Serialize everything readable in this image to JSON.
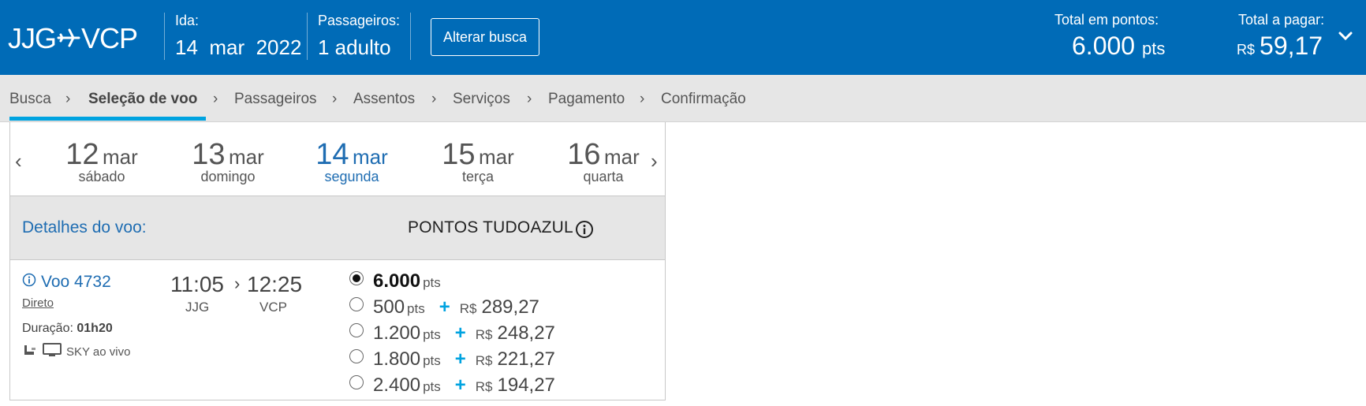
{
  "header": {
    "origin": "JJG",
    "destination": "VCP",
    "ida_label": "Ida:",
    "ida_date": "14  mar  2022",
    "passengers_label": "Passageiros:",
    "passengers_value": "1 adulto",
    "alter_button": "Alterar busca",
    "total_points_label": "Total em pontos:",
    "total_points_value": "6.000",
    "total_points_unit": "pts",
    "total_pay_label": "Total a pagar:",
    "total_pay_currency": "R$",
    "total_pay_value": "59,17"
  },
  "breadcrumb": {
    "steps": [
      "Busca",
      "Seleção de voo",
      "Passageiros",
      "Assentos",
      "Serviços",
      "Pagamento",
      "Confirmação"
    ],
    "active_index": 1
  },
  "dates": [
    {
      "day": "12",
      "month": "mar",
      "weekday": "sábado"
    },
    {
      "day": "13",
      "month": "mar",
      "weekday": "domingo"
    },
    {
      "day": "14",
      "month": "mar",
      "weekday": "segunda",
      "selected": true
    },
    {
      "day": "15",
      "month": "mar",
      "weekday": "terça"
    },
    {
      "day": "16",
      "month": "mar",
      "weekday": "quarta"
    }
  ],
  "details": {
    "title": "Detalhes do voo:",
    "points_title": "PONTOS TUDOAZUL"
  },
  "flight": {
    "number": "Voo 4732",
    "type": "Direto",
    "duration_label": "Duração:",
    "duration_value": "01h20",
    "amenity": "SKY ao vivo",
    "depart_time": "11:05",
    "arrive_time": "12:25",
    "depart_code": "JJG",
    "arrive_code": "VCP"
  },
  "fare_options": [
    {
      "points": "6.000",
      "unit": "pts",
      "selected": true
    },
    {
      "points": "500",
      "unit": "pts",
      "currency": "R$",
      "price": "289,27"
    },
    {
      "points": "1.200",
      "unit": "pts",
      "currency": "R$",
      "price": "248,27"
    },
    {
      "points": "1.800",
      "unit": "pts",
      "currency": "R$",
      "price": "221,27"
    },
    {
      "points": "2.400",
      "unit": "pts",
      "currency": "R$",
      "price": "194,27"
    }
  ],
  "colors": {
    "header_bg": "#006bb7",
    "accent": "#00a3e0",
    "link_blue": "#1f6db2"
  }
}
